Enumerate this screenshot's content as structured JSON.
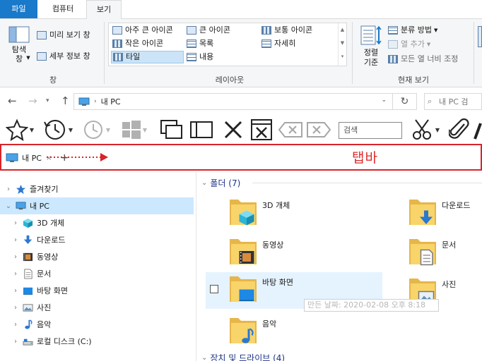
{
  "ribbon_tabs": {
    "file": "파일",
    "computer": "컴퓨터",
    "view": "보기"
  },
  "ribbon": {
    "pane_group": {
      "nav_pane_label": "탐색\n창",
      "preview_pane": "미리 보기 창",
      "details_pane": "세부 정보 창",
      "group_label": "창"
    },
    "layout_group": {
      "extra_large": "아주 큰 아이콘",
      "large": "큰 아이콘",
      "medium": "보통 아이콘",
      "small": "작은 아이콘",
      "list": "목록",
      "details": "자세히",
      "tiles": "타일",
      "content": "내용",
      "group_label": "레이아웃"
    },
    "current_view_group": {
      "sort_by": "정렬\n기준",
      "group_by": "분류 방법",
      "add_columns": "열 추가",
      "fit_columns": "모든 열 너비 조정",
      "group_label": "현재 보기"
    }
  },
  "address": {
    "path": "내 PC",
    "search_placeholder": "내 PC 검"
  },
  "toolbar": {
    "search_placeholder": "검색"
  },
  "tab_strip": {
    "tab_label": "내 PC",
    "annotation": "탭바"
  },
  "nav_pane": {
    "items": [
      {
        "label": "즐겨찾기",
        "icon": "star-icon",
        "level": 0
      },
      {
        "label": "내 PC",
        "icon": "monitor-icon",
        "level": 0
      },
      {
        "label": "3D 개체",
        "icon": "cube-icon",
        "level": 1
      },
      {
        "label": "다운로드",
        "icon": "download-icon",
        "level": 1
      },
      {
        "label": "동영상",
        "icon": "film-icon",
        "level": 1
      },
      {
        "label": "문서",
        "icon": "document-icon",
        "level": 1
      },
      {
        "label": "바탕 화면",
        "icon": "desktop-icon",
        "level": 1
      },
      {
        "label": "사진",
        "icon": "photo-icon",
        "level": 1
      },
      {
        "label": "음악",
        "icon": "music-icon",
        "level": 1
      },
      {
        "label": "로컬 디스크 (C:)",
        "icon": "drive-icon",
        "level": 1
      }
    ]
  },
  "content": {
    "folders_header": "폴더 (7)",
    "folders": [
      {
        "label": "3D 개체",
        "icon": "cube-icon"
      },
      {
        "label": "다운로드",
        "icon": "download-icon"
      },
      {
        "label": "동영상",
        "icon": "film-icon"
      },
      {
        "label": "문서",
        "icon": "document-icon"
      },
      {
        "label": "바탕 화면",
        "icon": "desktop-icon"
      },
      {
        "label": "사진",
        "icon": "photo-icon"
      },
      {
        "label": "음악",
        "icon": "music-icon"
      }
    ],
    "tooltip": "만든 날짜: 2020-02-08 오후 8:18",
    "devices_header": "장치 및 드라이브 (4)"
  },
  "colors": {
    "accent_blue": "#1979ca",
    "tab_strip_border": "#d8242b",
    "annotation_red": "#e02b2b",
    "selection": "#cce8ff",
    "folder_yellow": "#f8d46a"
  }
}
